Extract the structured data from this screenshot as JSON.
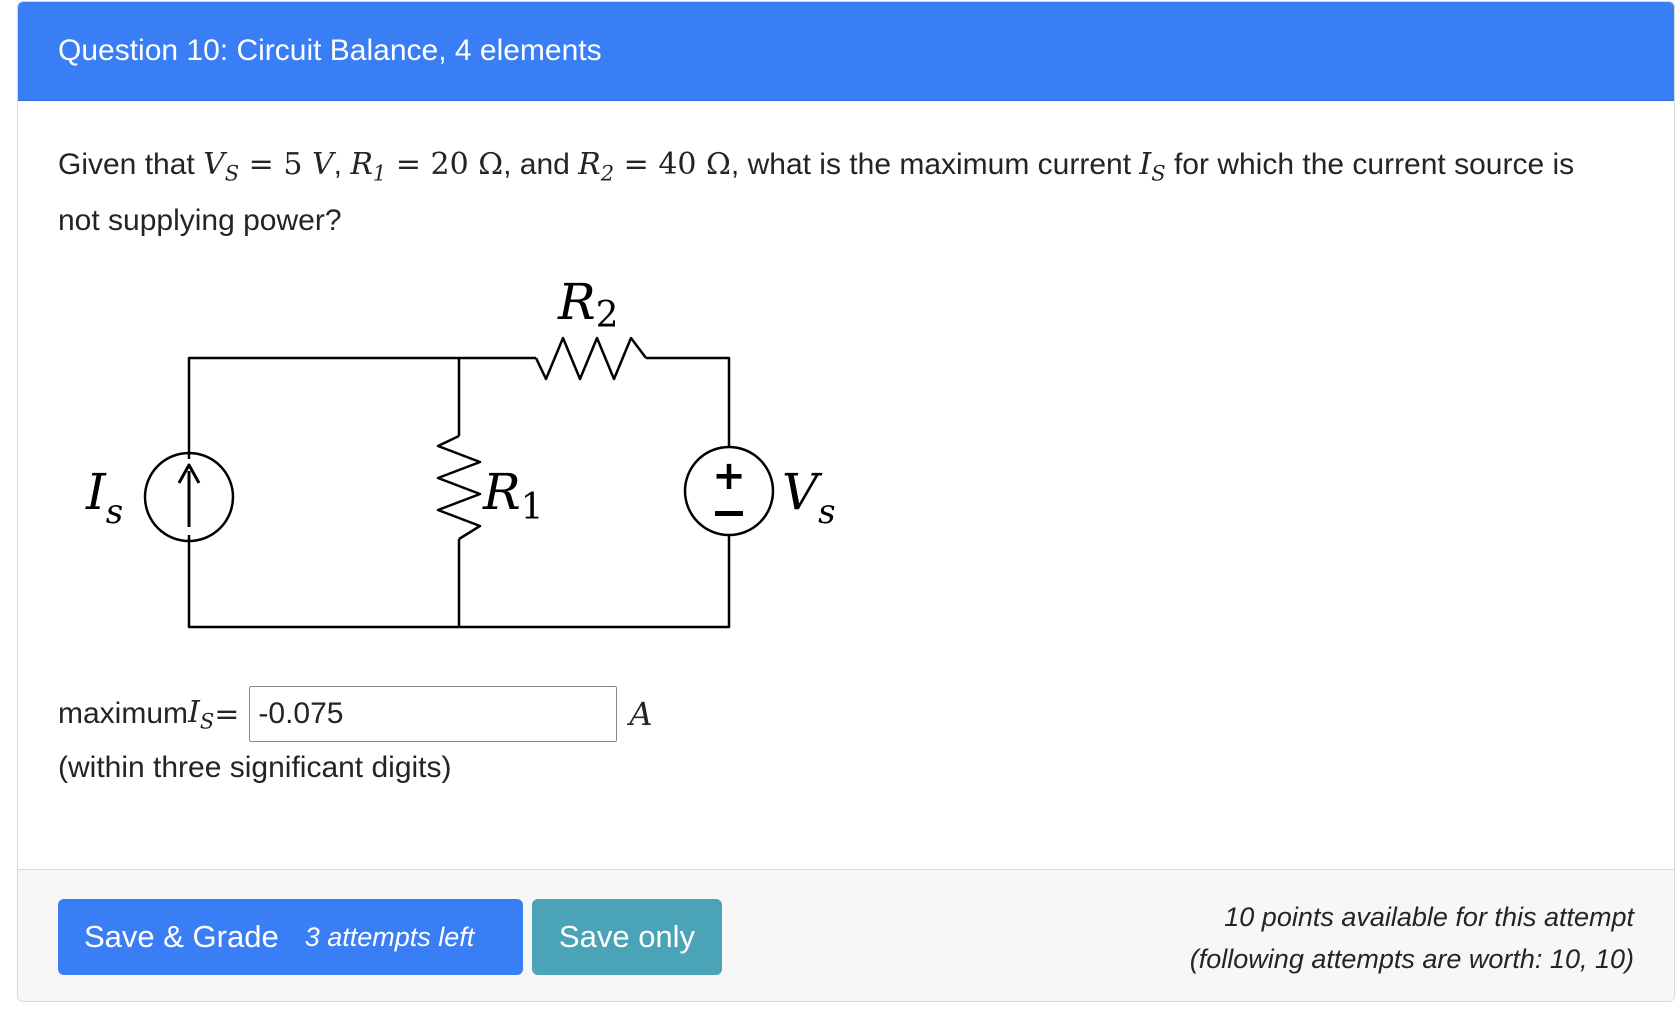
{
  "header": {
    "title": "Question 10: Circuit Balance, 4 elements"
  },
  "question": {
    "prefix": "Given that ",
    "vs_symbol": "V",
    "vs_sub": "S",
    "vs_eq": " = 5 ",
    "vs_unit": "V",
    "sep1": ", ",
    "r1_symbol": "R",
    "r1_sub": "1",
    "r1_eq": " = 20 ",
    "r1_unit": "Ω",
    "sep2": ", and ",
    "r2_symbol": "R",
    "r2_sub": "2",
    "r2_eq": " = 40 ",
    "r2_unit": "Ω",
    "mid": ", what is the maximum current ",
    "is_symbol": "I",
    "is_sub": "S",
    "suffix": " for which the current source is not supplying power?"
  },
  "circuit": {
    "r2_label": "R",
    "r2_sub": "2",
    "r1_label": "R",
    "r1_sub": "1",
    "is_label": "I",
    "is_sub": "s",
    "vs_label": "V",
    "vs_sub": "s",
    "plus": "+",
    "minus": "−"
  },
  "answer": {
    "prefix": "maximum ",
    "symbol": "I",
    "sub": "S",
    "eq": " =",
    "value": "-0.075",
    "unit": "A",
    "hint": "(within three significant digits)"
  },
  "footer": {
    "save_grade_label": "Save & Grade",
    "attempts_left": "3 attempts left",
    "save_only_label": "Save only",
    "points_line1": "10 points available for this attempt",
    "points_line2": "(following attempts are worth: 10, 10)"
  },
  "colors": {
    "primary": "#3a7ef5",
    "info": "#4aa3b6",
    "footer_bg": "#f7f7f7"
  }
}
